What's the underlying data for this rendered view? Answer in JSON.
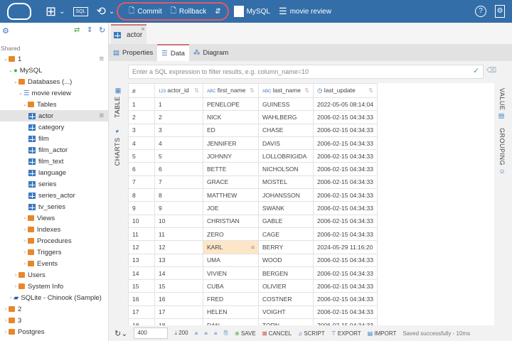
{
  "topbar": {
    "commit": "Commit",
    "rollback": "Rollback",
    "connection": "MySQL",
    "database": "movie review",
    "colors": {
      "bar": "#336ea8",
      "highlight": "#e05a6a"
    }
  },
  "sidebar": {
    "section": "Shared",
    "items": [
      {
        "label": "1",
        "level": 0,
        "icon": "folder",
        "open": true
      },
      {
        "label": "MySQL",
        "level": 1,
        "icon": "mysql",
        "open": true
      },
      {
        "label": "Databases (...)",
        "level": 2,
        "icon": "folder",
        "open": true
      },
      {
        "label": "movie review",
        "level": 3,
        "icon": "database",
        "open": true
      },
      {
        "label": "Tables",
        "level": 4,
        "icon": "folder",
        "open": true
      },
      {
        "label": "actor",
        "level": 5,
        "icon": "table",
        "selected": true
      },
      {
        "label": "category",
        "level": 5,
        "icon": "table"
      },
      {
        "label": "film",
        "level": 5,
        "icon": "table"
      },
      {
        "label": "film_actor",
        "level": 5,
        "icon": "table"
      },
      {
        "label": "film_text",
        "level": 5,
        "icon": "table"
      },
      {
        "label": "language",
        "level": 5,
        "icon": "table"
      },
      {
        "label": "series",
        "level": 5,
        "icon": "table"
      },
      {
        "label": "series_actor",
        "level": 5,
        "icon": "table"
      },
      {
        "label": "tv_series",
        "level": 5,
        "icon": "table"
      },
      {
        "label": "Views",
        "level": 4,
        "icon": "folder",
        "open": false
      },
      {
        "label": "Indexes",
        "level": 4,
        "icon": "folder",
        "open": false
      },
      {
        "label": "Procedures",
        "level": 4,
        "icon": "folder",
        "open": false
      },
      {
        "label": "Triggers",
        "level": 4,
        "icon": "folder",
        "open": false
      },
      {
        "label": "Events",
        "level": 4,
        "icon": "folder",
        "open": false
      },
      {
        "label": "Users",
        "level": 2,
        "icon": "folder",
        "open": false
      },
      {
        "label": "System Info",
        "level": 2,
        "icon": "folder",
        "open": false
      },
      {
        "label": "SQLite - Chinook (Sample)",
        "level": 1,
        "icon": "sqlite",
        "open": false
      },
      {
        "label": "2",
        "level": 0,
        "icon": "folder",
        "open": false
      },
      {
        "label": "3",
        "level": 0,
        "icon": "folder",
        "open": false
      },
      {
        "label": "Postgres",
        "level": 0,
        "icon": "folder",
        "open": false
      }
    ]
  },
  "editor": {
    "tab": "actor",
    "subtabs": [
      "Properties",
      "Data",
      "Diagram"
    ],
    "active_subtab": "Data",
    "filter_placeholder": "Enter a SQL expression to filter results, e.g. column_name=10",
    "left_tabs": [
      "TABLE",
      "CHARTS"
    ],
    "right_tabs": [
      "VALUE",
      "GROUPING"
    ],
    "columns": [
      {
        "label": "#",
        "type": ""
      },
      {
        "label": "actor_id",
        "type": "123"
      },
      {
        "label": "first_name",
        "type": "ABC"
      },
      {
        "label": "last_name",
        "type": "ABC"
      },
      {
        "label": "last_update",
        "type": "clock"
      }
    ],
    "rows": [
      [
        "1",
        "1",
        "PENELOPE",
        "GUINESS",
        "2022-05-05 08:14:04"
      ],
      [
        "2",
        "2",
        "NICK",
        "WAHLBERG",
        "2006-02-15 04:34:33"
      ],
      [
        "3",
        "3",
        "ED",
        "CHASE",
        "2006-02-15 04:34:33"
      ],
      [
        "4",
        "4",
        "JENNIFER",
        "DAVIS",
        "2006-02-15 04:34:33"
      ],
      [
        "5",
        "5",
        "JOHNNY",
        "LOLLOBRIGIDA",
        "2006-02-15 04:34:33"
      ],
      [
        "6",
        "6",
        "BETTE",
        "NICHOLSON",
        "2006-02-15 04:34:33"
      ],
      [
        "7",
        "7",
        "GRACE",
        "MOSTEL",
        "2006-02-15 04:34:33"
      ],
      [
        "8",
        "8",
        "MATTHEW",
        "JOHANSSON",
        "2006-02-15 04:34:33"
      ],
      [
        "9",
        "9",
        "JOE",
        "SWANK",
        "2006-02-15 04:34:33"
      ],
      [
        "10",
        "10",
        "CHRISTIAN",
        "GABLE",
        "2006-02-15 04:34:33"
      ],
      [
        "11",
        "11",
        "ZERO",
        "CAGE",
        "2006-02-15 04:34:33"
      ],
      [
        "12",
        "12",
        "KARL",
        "BERRY",
        "2024-05-29 11:16:20"
      ],
      [
        "13",
        "13",
        "UMA",
        "WOOD",
        "2006-02-15 04:34:33"
      ],
      [
        "14",
        "14",
        "VIVIEN",
        "BERGEN",
        "2006-02-15 04:34:33"
      ],
      [
        "15",
        "15",
        "CUBA",
        "OLIVIER",
        "2006-02-15 04:34:33"
      ],
      [
        "16",
        "16",
        "FRED",
        "COSTNER",
        "2006-02-15 04:34:33"
      ],
      [
        "17",
        "17",
        "HELEN",
        "VOIGHT",
        "2006-02-15 04:34:33"
      ],
      [
        "18",
        "18",
        "DAN",
        "TORN",
        "2006-02-15 04:34:33"
      ]
    ],
    "edited_cell": {
      "row": 12,
      "column": "first_name"
    },
    "bottom": {
      "fetch_size": "400",
      "fetch_more": "200",
      "save": "SAVE",
      "cancel": "CANCEL",
      "script": "SCRIPT",
      "export": "EXPORT",
      "import": "IMPORT",
      "status": "Saved successfully - 10ms"
    }
  },
  "watermark": "www.AhrefsPC.com"
}
